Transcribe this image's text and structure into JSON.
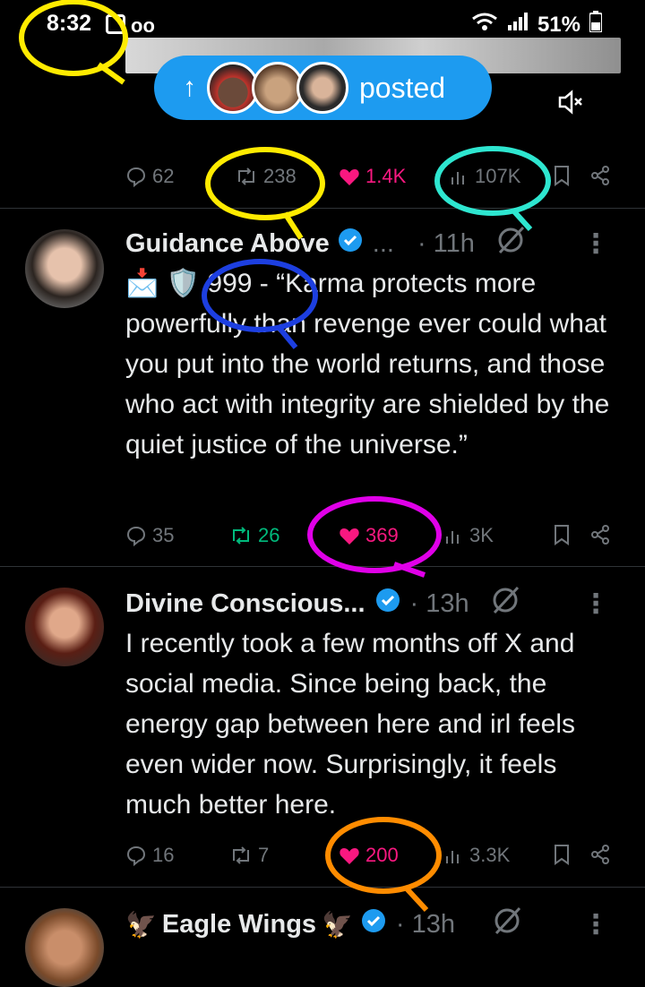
{
  "status_bar": {
    "time": "8:32",
    "battery": "51%"
  },
  "posted_pill": {
    "label": "posted"
  },
  "prev_post": {
    "replies": "62",
    "reposts": "238",
    "likes": "1.4K",
    "views": "107K"
  },
  "posts": [
    {
      "author": "Guidance Above",
      "ellipsis": "...",
      "time": "· 11h",
      "text_prefix": "📩 🛡️ ",
      "text": "999 - “Karma protects more powerfully than revenge ever could what you put into the world returns, and those who act with integrity are shielded by the quiet justice of the universe.”",
      "replies": "35",
      "reposts": "26",
      "likes": "369",
      "views": "3K"
    },
    {
      "author": "Divine Conscious...",
      "time": "· 13h",
      "text": "I recently took a few months off X and social media. Since being back, the energy gap between here and irl feels even wider now. Surprisingly, it feels much better here.",
      "replies": "16",
      "reposts": "7",
      "likes": "200",
      "views": "3.3K"
    },
    {
      "author": "Eagle Wings",
      "author_decoration": "🦅",
      "time": "· 13h"
    }
  ],
  "colors": {
    "accent": "#1d9bf0",
    "like": "#f91880",
    "repost_active": "#00ba7c",
    "annot_yellow": "#ffeb00",
    "annot_cyan": "#2ee6d0",
    "annot_blue": "#1d3fe0",
    "annot_magenta": "#e000e8",
    "annot_orange": "#ff8c00"
  }
}
